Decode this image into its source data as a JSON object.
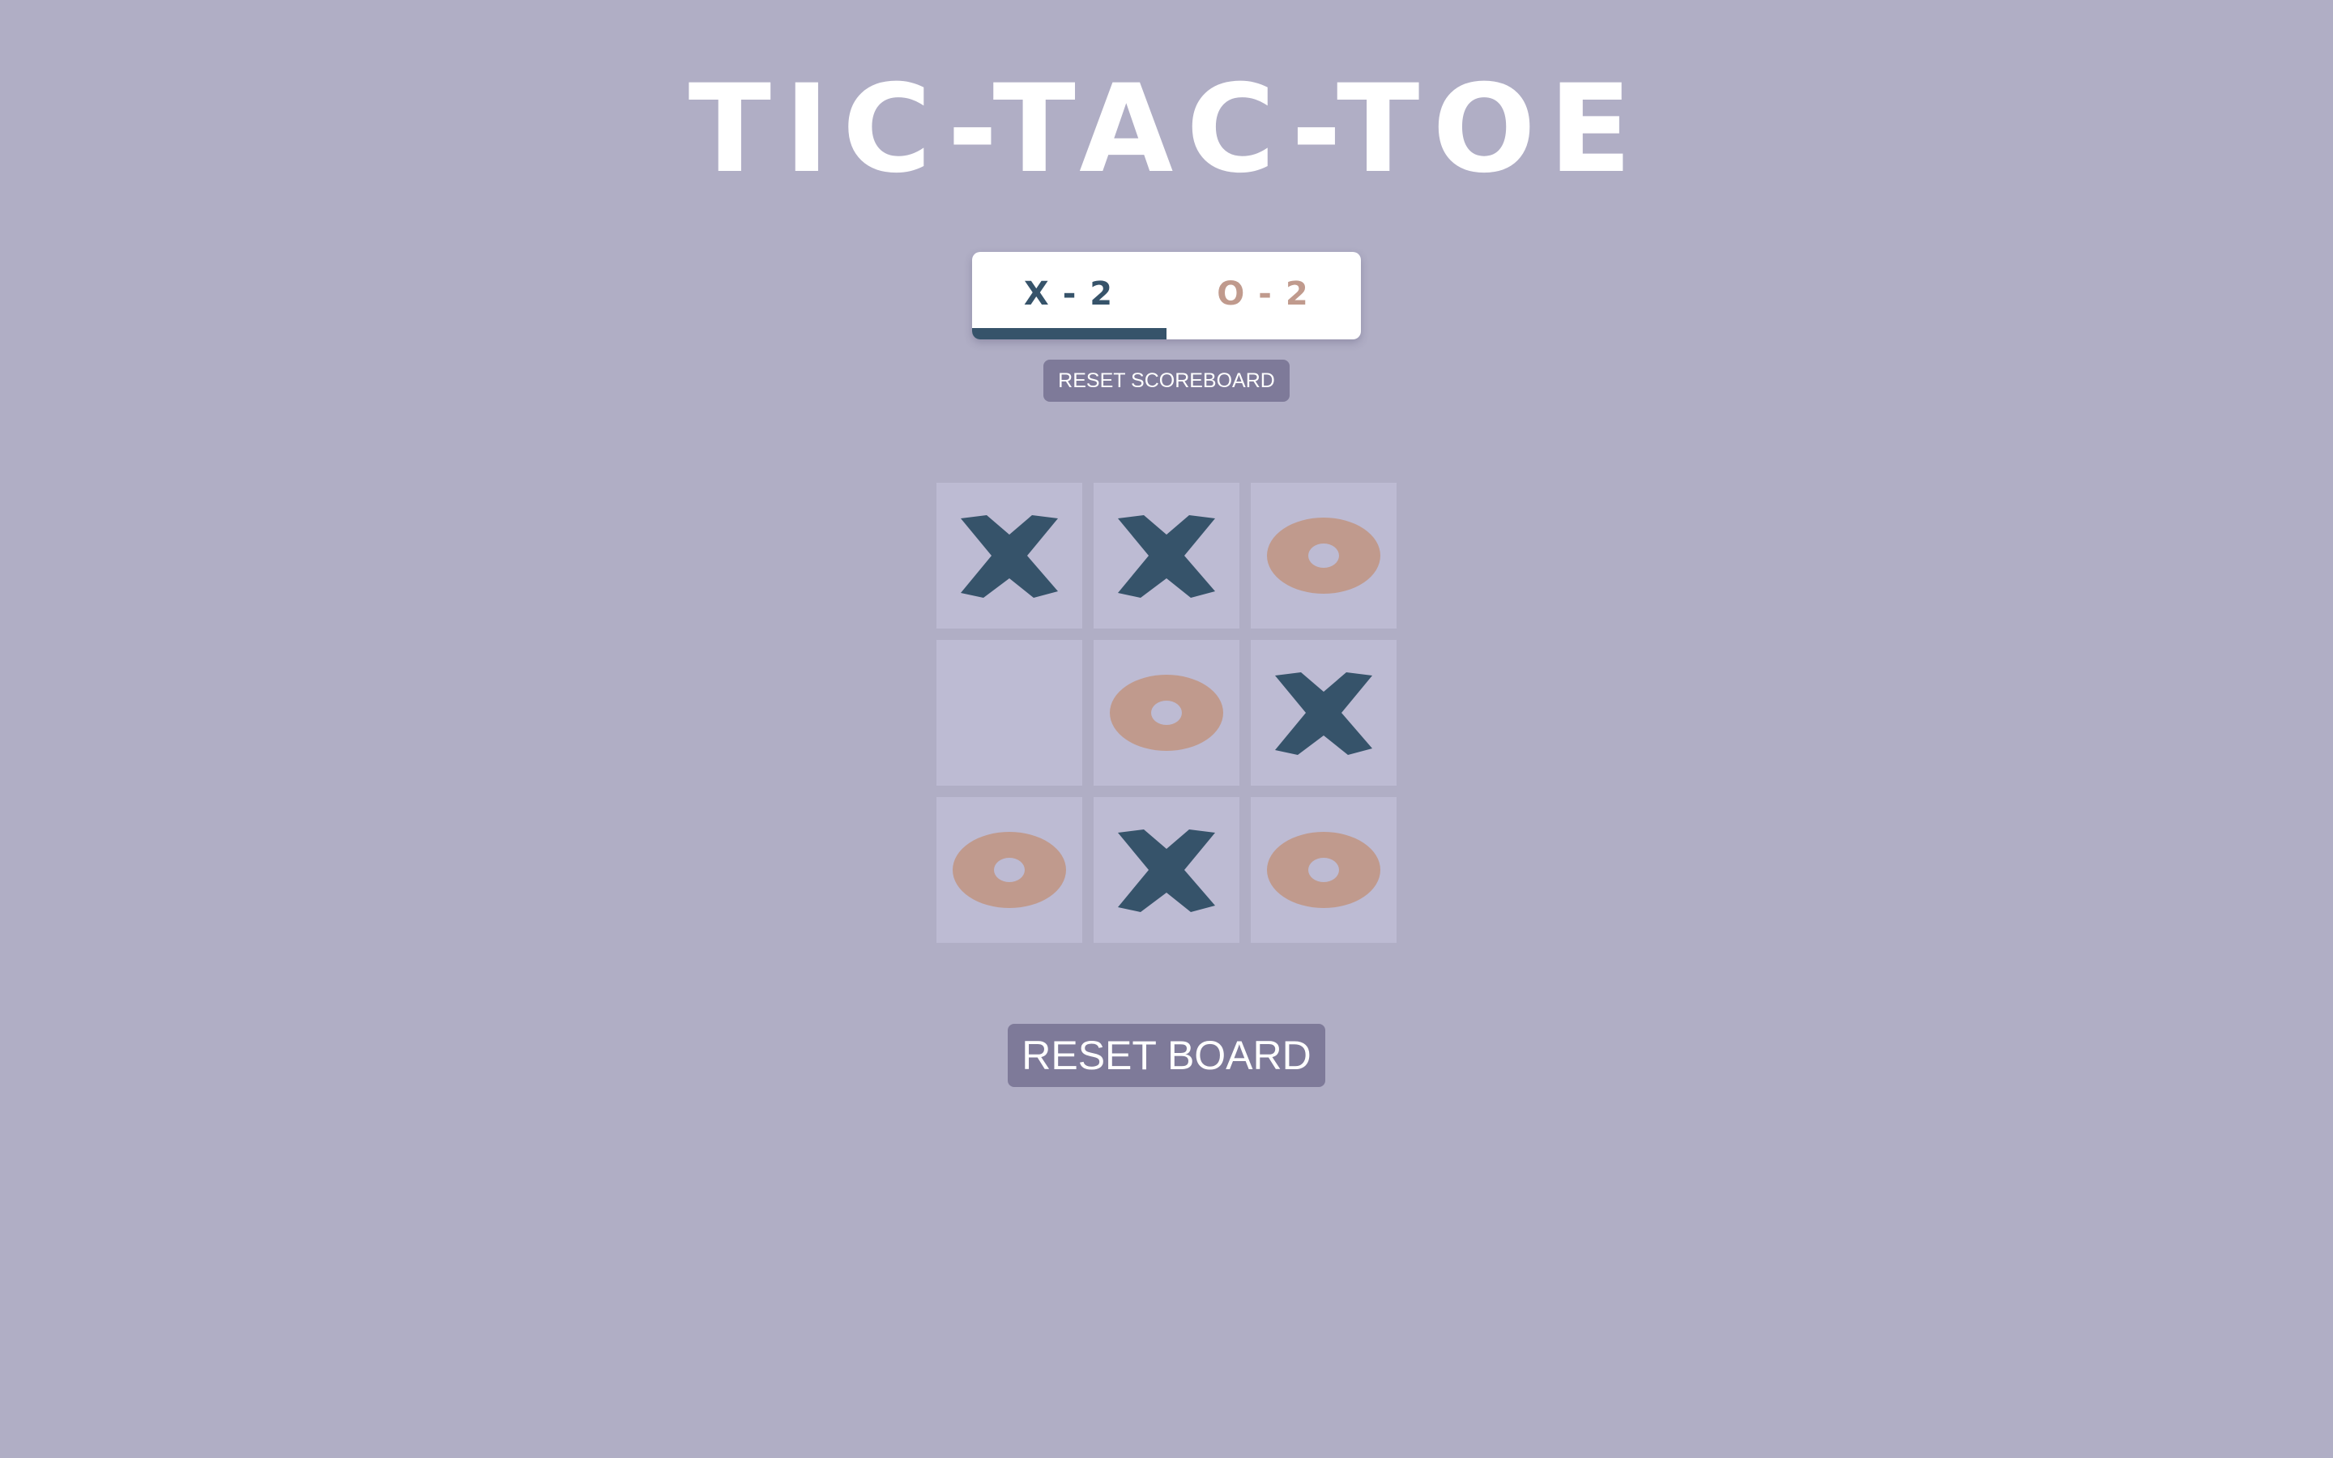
{
  "title": "TIC-TAC-TOE",
  "scoreboard": {
    "x": {
      "mark": "X",
      "separator": "-",
      "score": "2"
    },
    "o": {
      "mark": "O",
      "separator": "-",
      "score": "2"
    },
    "current_turn": "X"
  },
  "buttons": {
    "reset_scoreboard": "RESET SCOREBOARD",
    "reset_board": "RESET BOARD"
  },
  "board": [
    [
      "X",
      "X",
      "O"
    ],
    [
      "",
      "O",
      "X"
    ],
    [
      "O",
      "X",
      "O"
    ]
  ],
  "colors": {
    "background": "#b0aec5",
    "x": "#36536a",
    "o": "#c09a8d",
    "cell": "#bdbbd3",
    "button": "#7e7a99"
  }
}
